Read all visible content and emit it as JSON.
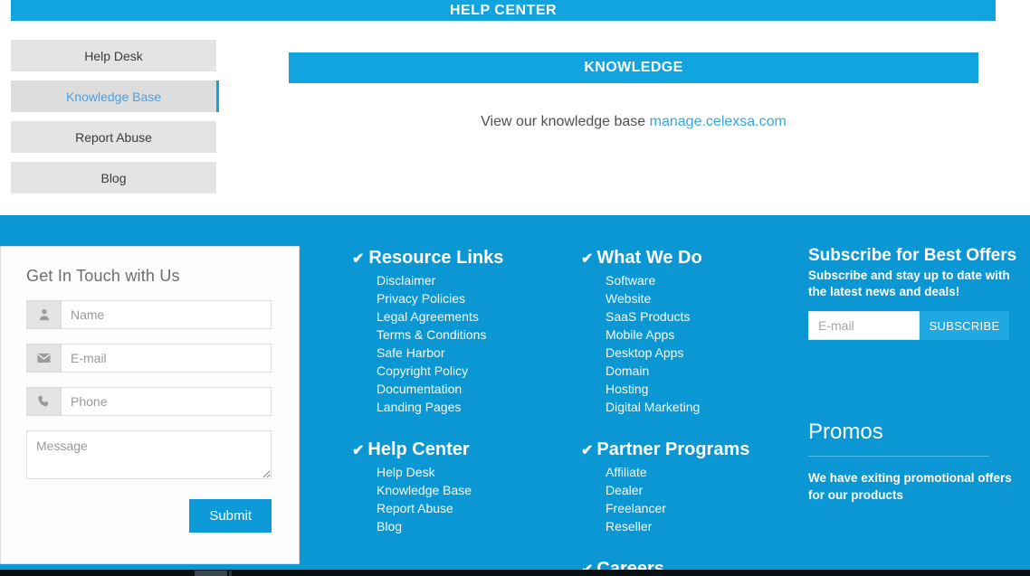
{
  "header": {
    "title": "HELP CENTER"
  },
  "sidebar": {
    "items": [
      {
        "label": "Help Desk",
        "active": false
      },
      {
        "label": "Knowledge Base",
        "active": true
      },
      {
        "label": "Report Abuse",
        "active": false
      },
      {
        "label": "Blog",
        "active": false
      }
    ]
  },
  "main": {
    "panel_title": "KNOWLEDGE",
    "body_text": "View our knowledge base ",
    "body_link": "manage.celexsa.com"
  },
  "contact": {
    "title": "Get In Touch with Us",
    "fields": [
      {
        "icon": "user-icon",
        "placeholder": "Name",
        "value": ""
      },
      {
        "icon": "envelope-icon",
        "placeholder": "E-mail",
        "value": ""
      },
      {
        "icon": "phone-icon",
        "placeholder": "Phone",
        "value": ""
      }
    ],
    "message_placeholder": "Message",
    "message_value": "",
    "submit_label": "Submit"
  },
  "footer": {
    "resource_links": {
      "heading": "Resource Links",
      "items": [
        "Disclaimer",
        "Privacy Policies",
        "Legal Agreements",
        "Terms & Conditions",
        "Safe Harbor",
        "Copyright Policy",
        "Documentation",
        "Landing Pages"
      ]
    },
    "help_center": {
      "heading": "Help Center",
      "items": [
        "Help Desk",
        "Knowledge Base",
        "Report Abuse",
        "Blog"
      ]
    },
    "what_we_do": {
      "heading": "What We Do",
      "items": [
        "Software",
        "Website",
        "SaaS Products",
        "Mobile Apps",
        "Desktop Apps",
        "Domain",
        "Hosting",
        "Digital Marketing"
      ]
    },
    "partner_programs": {
      "heading": "Partner Programs",
      "items": [
        "Affiliate",
        "Dealer",
        "Freelancer",
        "Reseller"
      ]
    },
    "careers": {
      "heading": "Careers"
    },
    "subscribe": {
      "title": "Subscribe for Best Offers",
      "description": "Subscribe and stay up to date with the latest news and deals!",
      "email_placeholder": "E-mail",
      "email_value": "",
      "button_label": "SUBSCRIBE"
    },
    "promos": {
      "title": "Promos",
      "text": "We have exiting promotional offers for our products"
    }
  },
  "icons": {
    "tick": "✔"
  },
  "colors": {
    "brand_blue": "#12a4df",
    "footer_blue": "#0b97d4",
    "sidebar_gray": "#e4e4e4",
    "active_link": "#4a9fe0"
  }
}
